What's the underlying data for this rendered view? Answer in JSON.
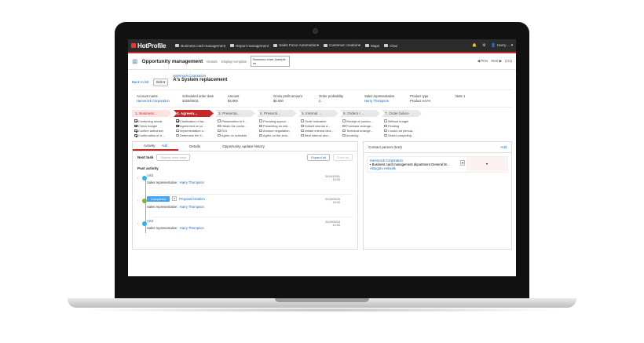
{
  "nav": {
    "logo": "HotProfile",
    "items": [
      {
        "label": "Business card management"
      },
      {
        "label": "Report management"
      },
      {
        "label": "Sales Force Automation▾"
      },
      {
        "label": "Customer creation▾"
      },
      {
        "label": "Maps"
      },
      {
        "label": "Chat"
      }
    ],
    "user": "Harry…"
  },
  "header": {
    "title": "Opportunity management",
    "sub": "Details",
    "template_label": "Display template",
    "template_value": "Business chart (sample se",
    "prev": "◀ Prev",
    "next": "Next ▶",
    "count": "(1/1)"
  },
  "top": {
    "back": "Back to list",
    "edit": "Edit",
    "company": "Hammock Corporation",
    "name": "A's System replacement"
  },
  "fields": [
    {
      "label": "Account name",
      "value": "Hammock Corporation",
      "link": true
    },
    {
      "label": "Scheduled order date",
      "value": "2020/03/31"
    },
    {
      "label": "Amount",
      "value": "$4,000"
    },
    {
      "label": "Gross profit amount",
      "value": "$0,000"
    },
    {
      "label": "Order probability",
      "value": "C"
    },
    {
      "label": "Sales representative",
      "value": "Harry Thompson",
      "link": true
    },
    {
      "label": "Product type",
      "value": "Product AAAA"
    },
    {
      "label": "Note 1",
      "value": ""
    }
  ],
  "steps": [
    {
      "label": "1. Business…",
      "checks": [
        [
          "Confirming needs",
          true
        ],
        [
          "Check budget",
          true
        ],
        [
          "Confirm authorizer",
          true
        ],
        [
          "Confirmation of vi…",
          true
        ]
      ]
    },
    {
      "label": "2. Agreem…",
      "checks": [
        [
          "Clarification of iss…",
          true
        ],
        [
          "Agreement on pr…",
          true
        ],
        [
          "Implementation o…",
          false
        ],
        [
          "Determine the fl…",
          false
        ]
      ]
    },
    {
      "label": "3. Presenta…",
      "checks": [
        [
          "Presentation to fl…",
          false
        ],
        [
          "Obtain the conse…",
          false
        ],
        [
          "ROI",
          false
        ],
        [
          "Agree on schedule",
          false
        ]
      ]
    },
    {
      "label": "4. Presenti…",
      "checks": [
        [
          "Providing approx…",
          false
        ],
        [
          "Presenting an esti…",
          false
        ],
        [
          "Amount negotiation",
          false
        ],
        [
          "Agree on the amo…",
          false
        ]
      ]
    },
    {
      "label": "5. Internal …",
      "checks": [
        [
          "Order indication",
          false
        ],
        [
          "Submit internal d…",
          false
        ],
        [
          "Initiate internal deci…",
          false
        ],
        [
          "Bind internal deci…",
          false
        ]
      ]
    },
    {
      "label": "6. Orders r…",
      "checks": [
        [
          "Receipt of purcha…",
          false
        ],
        [
          "Purchase arrange…",
          false
        ],
        [
          "Technical arrange…",
          false
        ],
        [
          "Invoicing",
          false
        ]
      ]
    },
    {
      "label": "7. Order failure",
      "checks": [
        [
          "Without budget",
          false
        ],
        [
          "Pending",
          false
        ],
        [
          "I could not persua…",
          false
        ],
        [
          "Select competing …",
          false
        ]
      ]
    }
  ],
  "tabs": {
    "activity": "Activity",
    "add": "Add",
    "details": "Details",
    "history": "Opportunity update history"
  },
  "nexttask": {
    "label": "Next task",
    "more": "Display more days",
    "expand": "Expand all",
    "show": "Show all"
  },
  "past_label": "Past activity",
  "activities": [
    {
      "type": "Visit",
      "rep_label": "Sales representative : ",
      "rep": "Harry Thompson",
      "date": "2019/10/01",
      "time": "10:00"
    },
    {
      "type": "Proposal creation",
      "status": "Completed",
      "rep_label": "Sales representative : ",
      "rep": "Harry Thompson",
      "date": "2019/09/25",
      "time": "10:00"
    },
    {
      "type": "Visit",
      "rep_label": "Sales representative : ",
      "rep": "Harry Thompson",
      "date": "2019/09/18",
      "time": "10:00"
    }
  ],
  "contact": {
    "title": "Contact person (text)",
    "add": "Add",
    "company": "Hammock Corporation",
    "dept": "Business card management department General M…",
    "person": "Atsuguro Hotsolle"
  }
}
